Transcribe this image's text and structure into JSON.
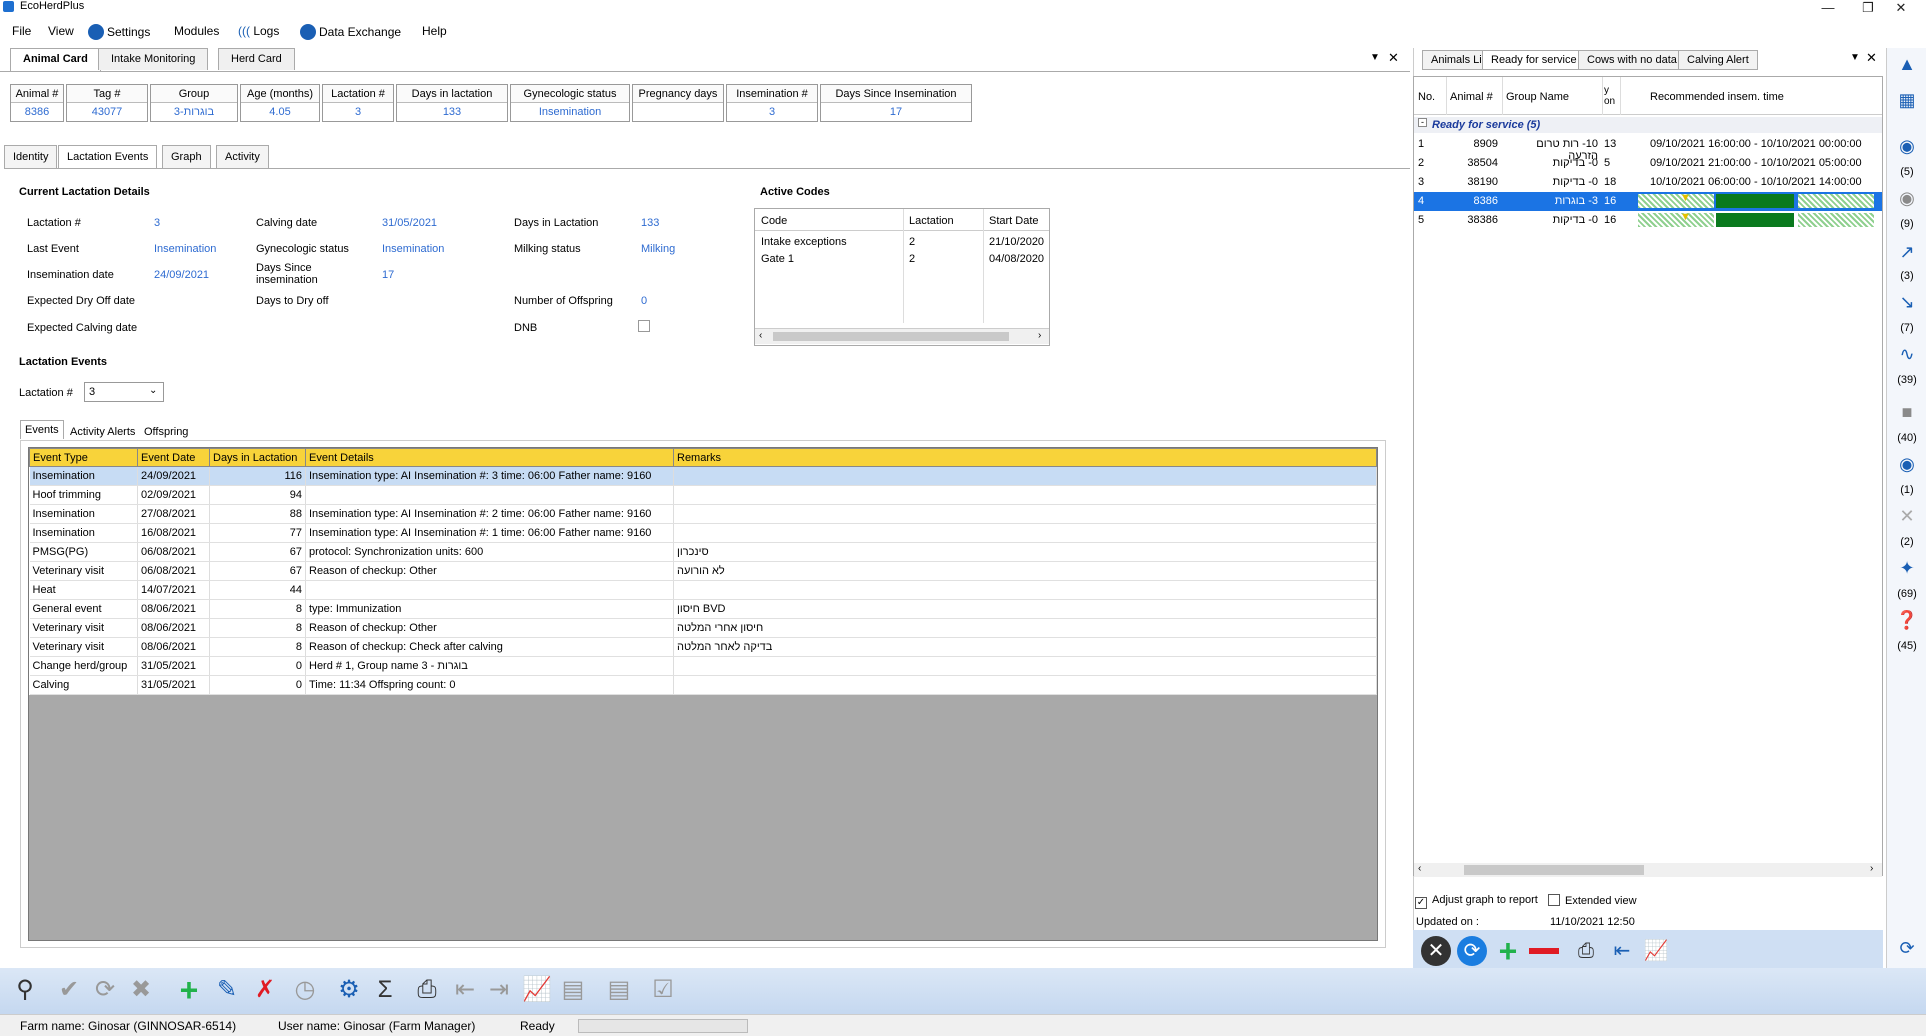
{
  "app": {
    "title": "EcoHerdPlus"
  },
  "menu": {
    "file": "File",
    "view": "View",
    "settings": "Settings",
    "modules": "Modules",
    "logs": "Logs",
    "data_exchange": "Data Exchange",
    "help": "Help"
  },
  "tabs": {
    "animal_card": "Animal Card",
    "intake": "Intake Monitoring",
    "herd_card": "Herd Card"
  },
  "header": {
    "labels": [
      "Animal #",
      "Tag #",
      "Group",
      "Age (months)",
      "Lactation #",
      "Days in lactation",
      "Gynecologic status",
      "Pregnancy days",
      "Insemination #",
      "Days Since Insemination"
    ],
    "values": [
      "8386",
      "43077",
      "3-בוגרות",
      "4.05",
      "3",
      "133",
      "Insemination",
      "",
      "3",
      "17"
    ]
  },
  "subtabs": {
    "identity": "Identity",
    "lactation_events": "Lactation Events",
    "graph": "Graph",
    "activity": "Activity"
  },
  "details": {
    "title": "Current Lactation Details",
    "lactation_label": "Lactation #",
    "lactation": "3",
    "last_event_label": "Last Event",
    "last_event": "Insemination",
    "insem_date_label": "Insemination date",
    "insem_date": "24/09/2021",
    "exp_dry_label": "Expected Dry Off date",
    "exp_calving_label": "Expected Calving date",
    "calving_date_label": "Calving date",
    "calving_date": "31/05/2021",
    "gyn_label": "Gynecologic status",
    "gyn": "Insemination",
    "days_since_label": "Days Since insemination",
    "days_since": "17",
    "days_dry_label": "Days to Dry off",
    "dil_label": "Days in Lactation",
    "dil": "133",
    "milking_label": "Milking status",
    "milking": "Milking",
    "offspring_label": "Number of Offspring",
    "offspring": "0",
    "dnb_label": "DNB"
  },
  "active_codes": {
    "title": "Active Codes",
    "headers": [
      "Code",
      "Lactation",
      "Start Date"
    ],
    "rows": [
      [
        "Intake exceptions",
        "2",
        "21/10/2020"
      ],
      [
        "Gate 1",
        "2",
        "04/08/2020"
      ]
    ]
  },
  "events": {
    "title": "Lactation Events",
    "lactation_label": "Lactation #",
    "lactation_value": "3",
    "tabs": [
      "Events",
      "Activity Alerts",
      "Offspring"
    ],
    "headers": [
      "Event Type",
      "Event Date",
      "Days in Lactation",
      "Event Details",
      "Remarks"
    ],
    "rows": [
      [
        "Insemination",
        "24/09/2021",
        "116",
        "Insemination type: AI   Insemination #: 3  time: 06:00   Father name: 9160",
        ""
      ],
      [
        "Hoof trimming",
        "02/09/2021",
        "94",
        "",
        ""
      ],
      [
        "Insemination",
        "27/08/2021",
        "88",
        "Insemination type: AI   Insemination #: 2  time: 06:00   Father name: 9160",
        ""
      ],
      [
        "Insemination",
        "16/08/2021",
        "77",
        "Insemination type: AI   Insemination #: 1  time: 06:00   Father name: 9160",
        ""
      ],
      [
        "PMSG(PG)",
        "06/08/2021",
        "67",
        "protocol: Synchronization   units: 600",
        "סינכרון"
      ],
      [
        "Veterinary visit",
        "06/08/2021",
        "67",
        "Reason of checkup: Other",
        "לא הורועה"
      ],
      [
        "Heat",
        "14/07/2021",
        "44",
        "",
        ""
      ],
      [
        "General event",
        "08/06/2021",
        "8",
        "type: Immunization",
        "חיסון BVD"
      ],
      [
        "Veterinary visit",
        "08/06/2021",
        "8",
        "Reason of checkup: Other",
        "חיסון אחרי המלטה"
      ],
      [
        "Veterinary visit",
        "08/06/2021",
        "8",
        "Reason of checkup: Check after calving",
        "בדיקה לאחר המלטה"
      ],
      [
        "Change herd/group",
        "31/05/2021",
        "0",
        "Herd # 1, Group name 3 - בוגרות",
        ""
      ],
      [
        "Calving",
        "31/05/2021",
        "0",
        "Time: 11:34  Offspring count: 0",
        ""
      ]
    ]
  },
  "right_panel": {
    "tabs": [
      "Animals List",
      "Ready for service",
      "Cows with no data",
      "Calving Alert"
    ],
    "headers": [
      "No.",
      "Animal #",
      "Group Name",
      "y on",
      "Recommended insem. time"
    ],
    "group_title": "Ready for service (5)",
    "rows": [
      [
        "1",
        "8909",
        "10- רות טרום הזרעה",
        "13",
        "09/10/2021 16:00:00 - 10/10/2021 00:00:00"
      ],
      [
        "2",
        "38504",
        "0- בדיקות",
        "5",
        "09/10/2021 21:00:00 - 10/10/2021 05:00:00"
      ],
      [
        "3",
        "38190",
        "0- בדיקות",
        "18",
        "10/10/2021 06:00:00 - 10/10/2021 14:00:00"
      ],
      [
        "4",
        "8386",
        "3- בוגרות",
        "16",
        ""
      ],
      [
        "5",
        "38386",
        "0- בדיקות",
        "16",
        ""
      ]
    ],
    "adjust_label": "Adjust graph to report",
    "extended_label": "Extended view",
    "updated_label": "Updated on :",
    "updated_value": "11/10/2021 12:50"
  },
  "sidebar_counts": [
    "(5)",
    "(9)",
    "(3)",
    "(7)",
    "(39)",
    "(40)",
    "(1)",
    "(2)",
    "(69)",
    "(45)"
  ],
  "status": {
    "farm": "Farm name: Ginosar (GINNOSAR-6514)",
    "user": "User name: Ginosar (Farm Manager)",
    "ready": "Ready"
  }
}
